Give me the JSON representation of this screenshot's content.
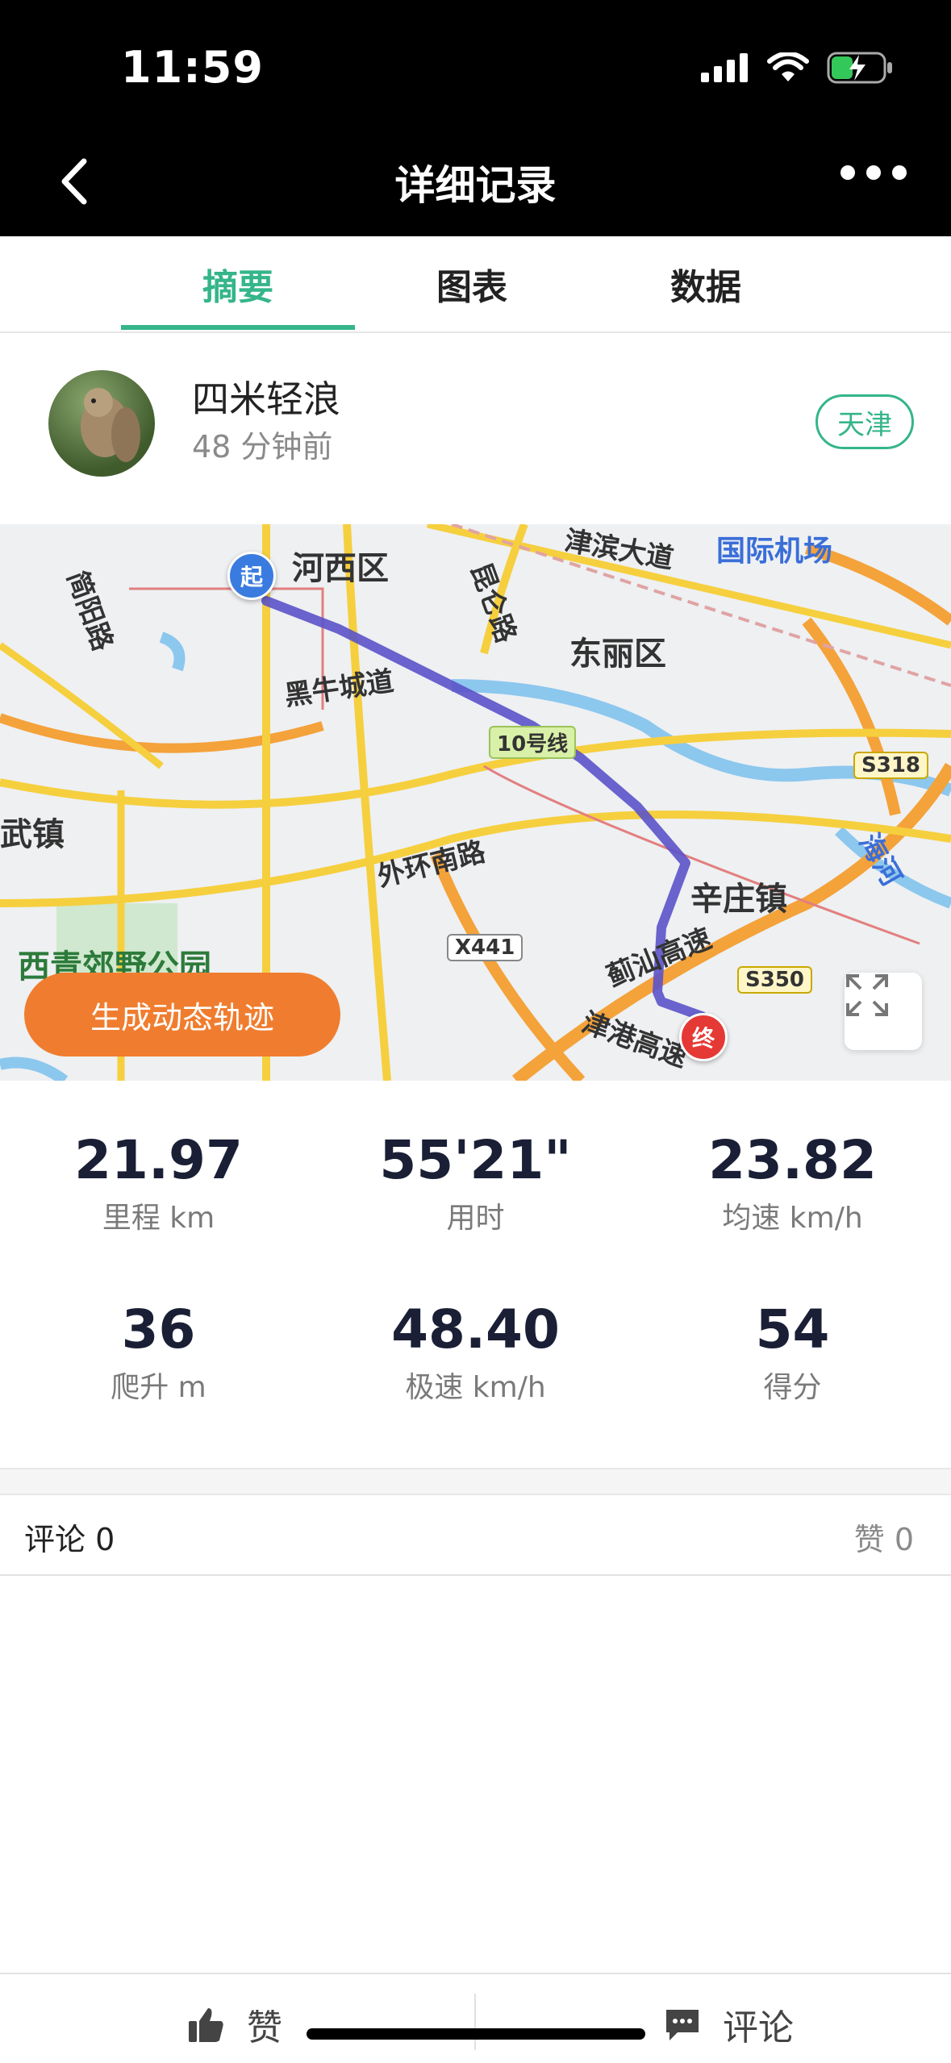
{
  "status_bar": {
    "time": "11:59"
  },
  "nav": {
    "title": "详细记录"
  },
  "tabs": [
    {
      "label": "摘要",
      "active": true
    },
    {
      "label": "图表",
      "active": false
    },
    {
      "label": "数据",
      "active": false
    }
  ],
  "user": {
    "name": "四米轻浪",
    "time_ago": "48 分钟前",
    "city": "天津"
  },
  "map": {
    "start_label": "起",
    "end_label": "终",
    "labels": {
      "hexi": "河西区",
      "dongli": "东丽区",
      "airport": "国际机场",
      "xinzhuang": "辛庄镇",
      "wuzhen": "武镇",
      "park": "西青郊野公园",
      "heniu": "黑牛城道",
      "waihuan": "外环南路",
      "jinbin": "津滨大道",
      "kunlun": "昆仑路",
      "jiyang": "简阳路",
      "jishan": "蓟汕高速",
      "jingang": "津港高速",
      "haihe": "海河",
      "line10": "10号线"
    },
    "road_badges": {
      "s318": "S318",
      "s350": "S350",
      "x441": "X441"
    },
    "generate_button": "生成动态轨迹"
  },
  "stats": [
    {
      "value": "21.97",
      "label": "里程 km"
    },
    {
      "value": "55'21\"",
      "label": "用时"
    },
    {
      "value": "23.82",
      "label": "均速 km/h"
    },
    {
      "value": "36",
      "label": "爬升 m"
    },
    {
      "value": "48.40",
      "label": "极速 km/h"
    },
    {
      "value": "54",
      "label": "得分"
    }
  ],
  "comments": {
    "comment_count": "评论 0",
    "like_count": "赞 0"
  },
  "bottom_bar": {
    "like": "赞",
    "comment": "评论"
  },
  "colors": {
    "accent": "#35b58a",
    "orange": "#f07d2f",
    "route": "#5b52c9"
  }
}
